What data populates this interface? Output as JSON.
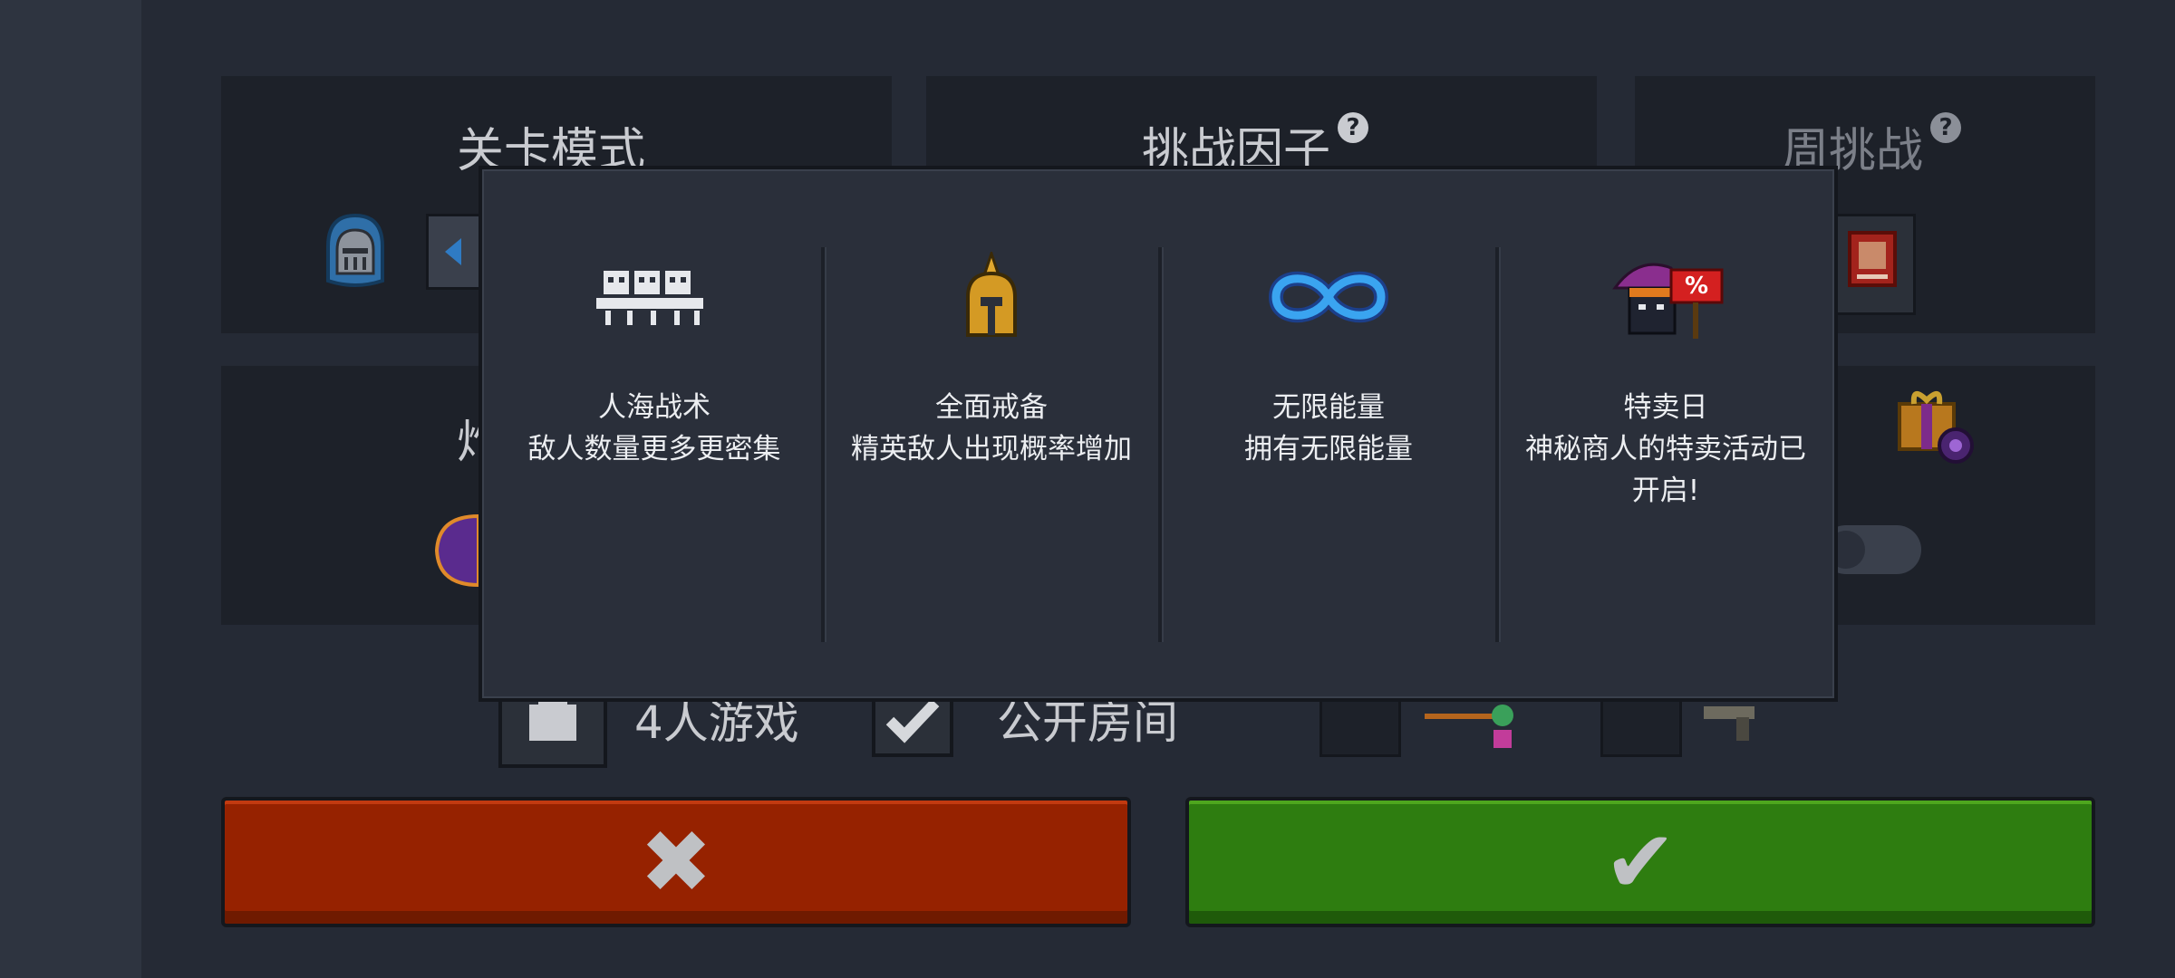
{
  "headers": {
    "level_mode": "关卡模式",
    "challenge_factor": "挑战因子",
    "weekly_challenge": "周挑战",
    "help_glyph": "?"
  },
  "background": {
    "obscured_char": "炸",
    "players_label": "4人游戏",
    "public_room_label": "公开房间"
  },
  "modal": {
    "factors": [
      {
        "icon": "skeleton-horde-icon",
        "title": "人海战术",
        "desc": "敌人数量更多更密集"
      },
      {
        "icon": "golden-helmet-icon",
        "title": "全面戒备",
        "desc": "精英敌人出现概率增加"
      },
      {
        "icon": "infinity-icon",
        "title": "无限能量",
        "desc": "拥有无限能量"
      },
      {
        "icon": "merchant-sale-icon",
        "title": "特卖日",
        "desc": "神秘商人的特卖活动已开启!"
      }
    ]
  },
  "buttons": {
    "cancel_glyph": "✖",
    "confirm_glyph": "✔"
  },
  "colors": {
    "cancel": "#962200",
    "confirm": "#2e7d10",
    "modal_bg": "#2a2f3a"
  }
}
